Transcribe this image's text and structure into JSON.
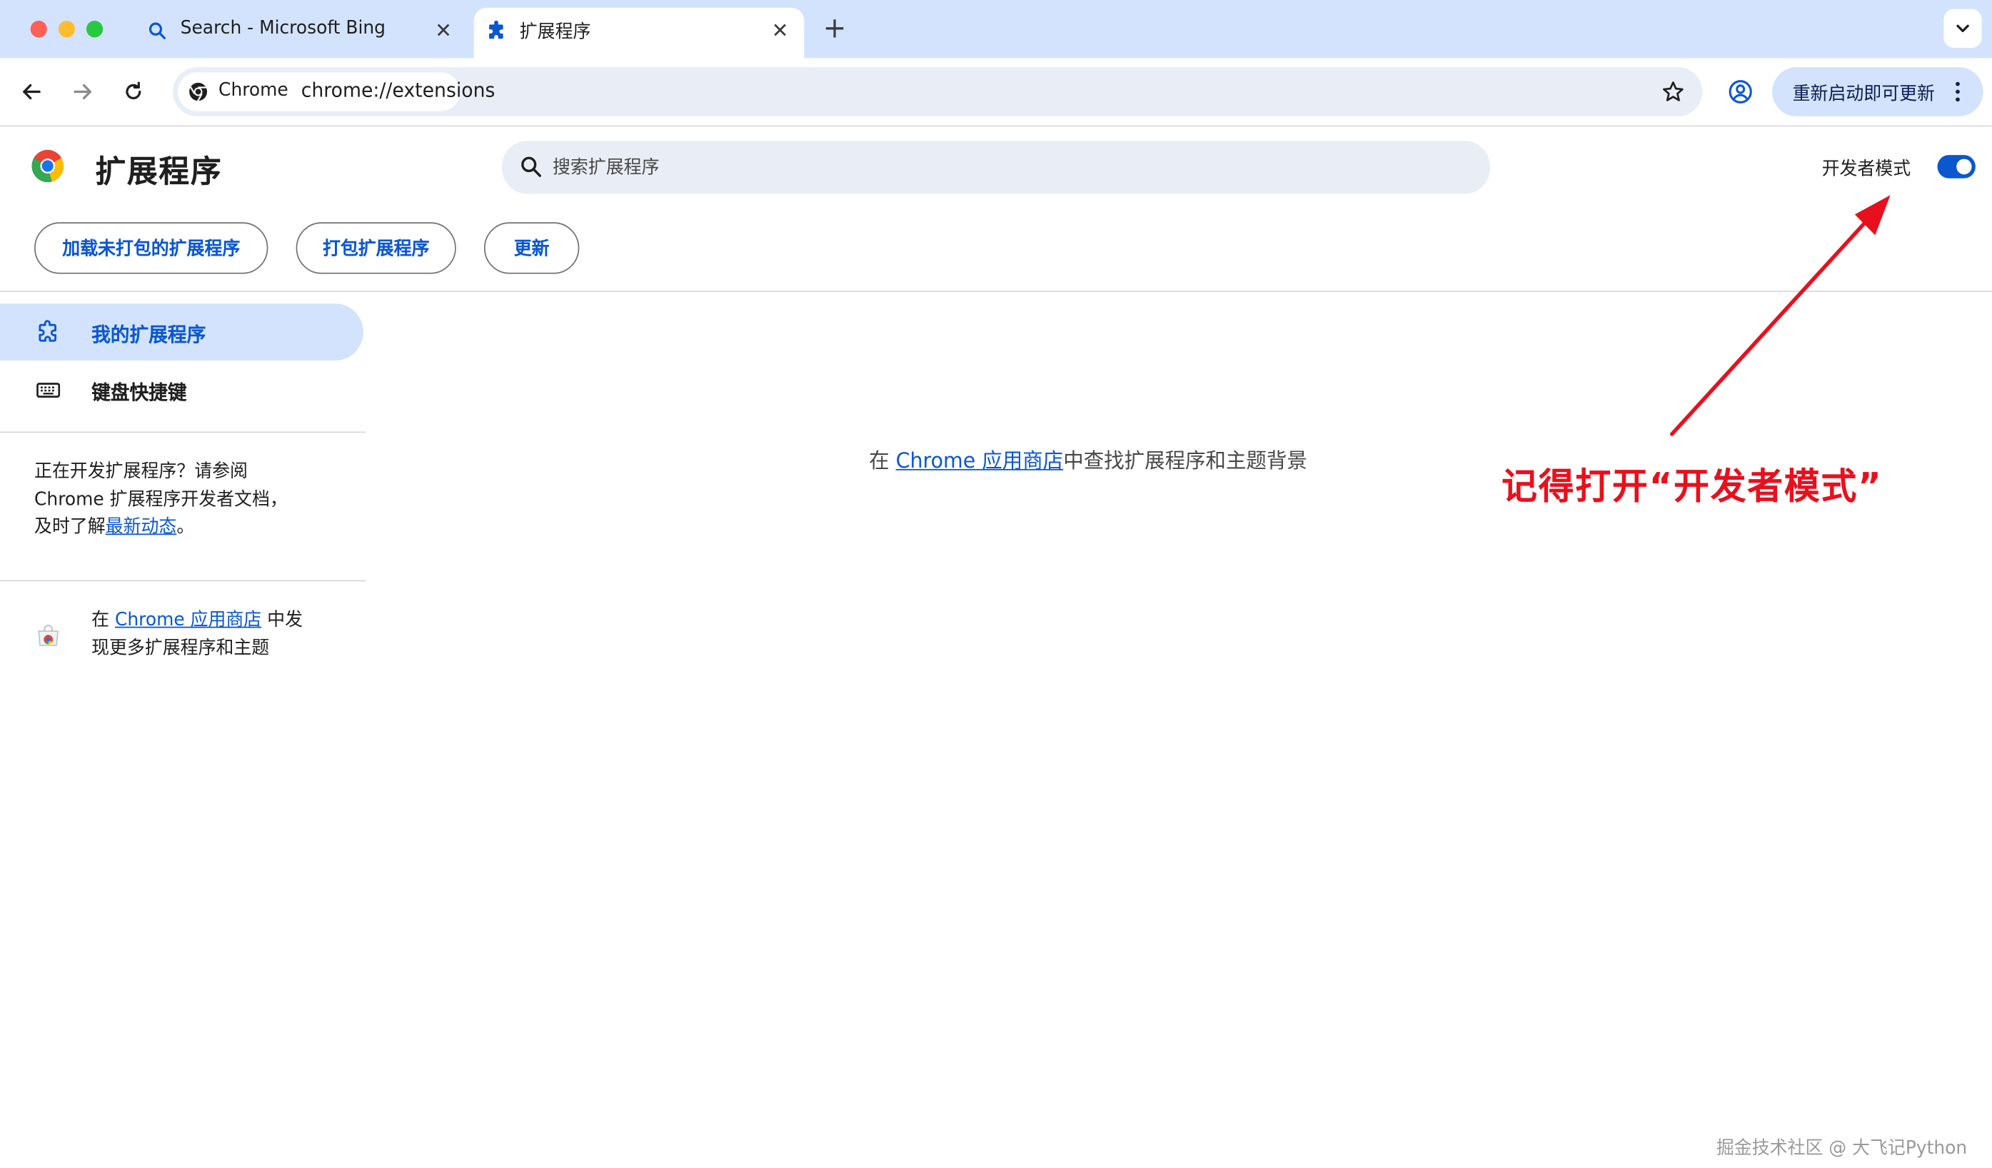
{
  "window": {
    "tabs": [
      {
        "title": "Search - Microsoft Bing",
        "icon": "search-icon",
        "active": false
      },
      {
        "title": "扩展程序",
        "icon": "puzzle-icon",
        "active": true
      }
    ]
  },
  "toolbar": {
    "chip_label": "Chrome",
    "url": "chrome://extensions",
    "update_label": "重新启动即可更新"
  },
  "page": {
    "title": "扩展程序",
    "search_placeholder": "搜索扩展程序",
    "dev_mode_label": "开发者模式",
    "dev_mode_on": true,
    "buttons": {
      "load_unpacked": "加载未打包的扩展程序",
      "pack": "打包扩展程序",
      "update": "更新"
    }
  },
  "sidebar": {
    "items": [
      {
        "label": "我的扩展程序",
        "icon": "extension-icon",
        "active": true
      },
      {
        "label": "键盘快捷键",
        "icon": "keyboard-icon",
        "active": false
      }
    ],
    "dev_note": {
      "line1": "正在开发扩展程序？请参阅",
      "line2": "Chrome 扩展程序开发者文档，",
      "line3_prefix": "及时了解",
      "line3_link": "最新动态",
      "line3_suffix": "。"
    },
    "store": {
      "prefix": "在 ",
      "link": "Chrome 应用商店",
      "suffix": " 中发",
      "line2": "现更多扩展程序和主题"
    }
  },
  "main": {
    "prefix": "在 ",
    "link": "Chrome 应用商店",
    "suffix": "中查找扩展程序和主题背景"
  },
  "annotation": {
    "text": "记得打开“开发者模式”",
    "color": "#e8101d"
  },
  "watermark": "掘金技术社区 @ 大飞记Python",
  "colors": {
    "accent": "#0b57d0",
    "tabstrip": "#d3e3fd",
    "omnibox": "#e9eef6"
  }
}
